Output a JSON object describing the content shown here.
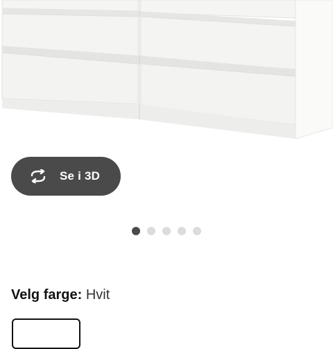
{
  "product_image": {
    "subject": "white chest of drawers"
  },
  "view_3d": {
    "label": "Se i 3D",
    "icon": "rotate-3d-icon"
  },
  "carousel": {
    "count": 5,
    "active_index": 0
  },
  "color": {
    "label": "Velg farge:",
    "value": "Hvit"
  },
  "colors": {
    "button_bg": "#4a4a4a",
    "dot_active": "#4a4a4a",
    "dot_inactive": "#dcdcdc",
    "text": "#111111"
  }
}
